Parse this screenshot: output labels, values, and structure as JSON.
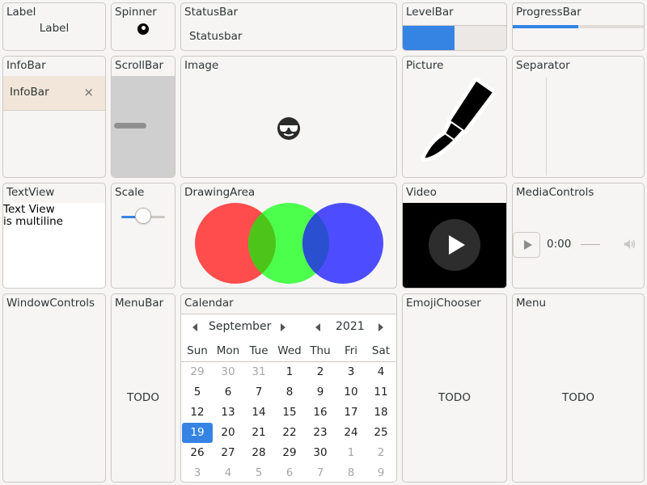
{
  "tiles": {
    "label": {
      "title": "Label",
      "text": "Label"
    },
    "spinner": {
      "title": "Spinner"
    },
    "statusbar": {
      "title": "StatusBar",
      "text": "Statusbar"
    },
    "levelbar": {
      "title": "LevelBar",
      "value": 0.5
    },
    "progressbar": {
      "title": "ProgressBar",
      "value": 0.5
    },
    "infobar": {
      "title": "InfoBar",
      "text": "InfoBar",
      "close_glyph": "×"
    },
    "scrollbar": {
      "title": "ScrollBar"
    },
    "image": {
      "title": "Image",
      "icon": "sunglasses-face-icon"
    },
    "picture": {
      "title": "Picture",
      "icon": "paintbrush-icon"
    },
    "separator": {
      "title": "Separator"
    },
    "textview": {
      "title": "TextView",
      "lines": [
        "Text View",
        "is multiline"
      ]
    },
    "scale": {
      "title": "Scale",
      "value": 0.5
    },
    "drawingarea": {
      "title": "DrawingArea",
      "circle_colors": [
        "#ff4d4d",
        "#4dff4d",
        "#4d4dff"
      ]
    },
    "video": {
      "title": "Video"
    },
    "mediacontrols": {
      "title": "MediaControls",
      "time": "0:00"
    },
    "windowcontrols": {
      "title": "WindowControls"
    },
    "menubar": {
      "title": "MenuBar",
      "todo": "TODO"
    },
    "calendar": {
      "title": "Calendar"
    },
    "emojichooser": {
      "title": "EmojiChooser",
      "todo": "TODO"
    },
    "menu": {
      "title": "Menu",
      "todo": "TODO"
    }
  },
  "calendar": {
    "month": "September",
    "year": "2021",
    "weekdays": [
      "Sun",
      "Mon",
      "Tue",
      "Wed",
      "Thu",
      "Fri",
      "Sat"
    ],
    "weeks": [
      [
        29,
        30,
        31,
        1,
        2,
        3,
        4
      ],
      [
        5,
        6,
        7,
        8,
        9,
        10,
        11
      ],
      [
        12,
        13,
        14,
        15,
        16,
        17,
        18
      ],
      [
        19,
        20,
        21,
        22,
        23,
        24,
        25
      ],
      [
        26,
        27,
        28,
        29,
        30,
        1,
        2
      ],
      [
        3,
        4,
        5,
        6,
        7,
        8,
        9
      ]
    ],
    "selected_day": 19
  },
  "colors": {
    "accent": "#3584e4",
    "infobar_bg": "#f1e6d9",
    "video_bg": "#000000"
  }
}
